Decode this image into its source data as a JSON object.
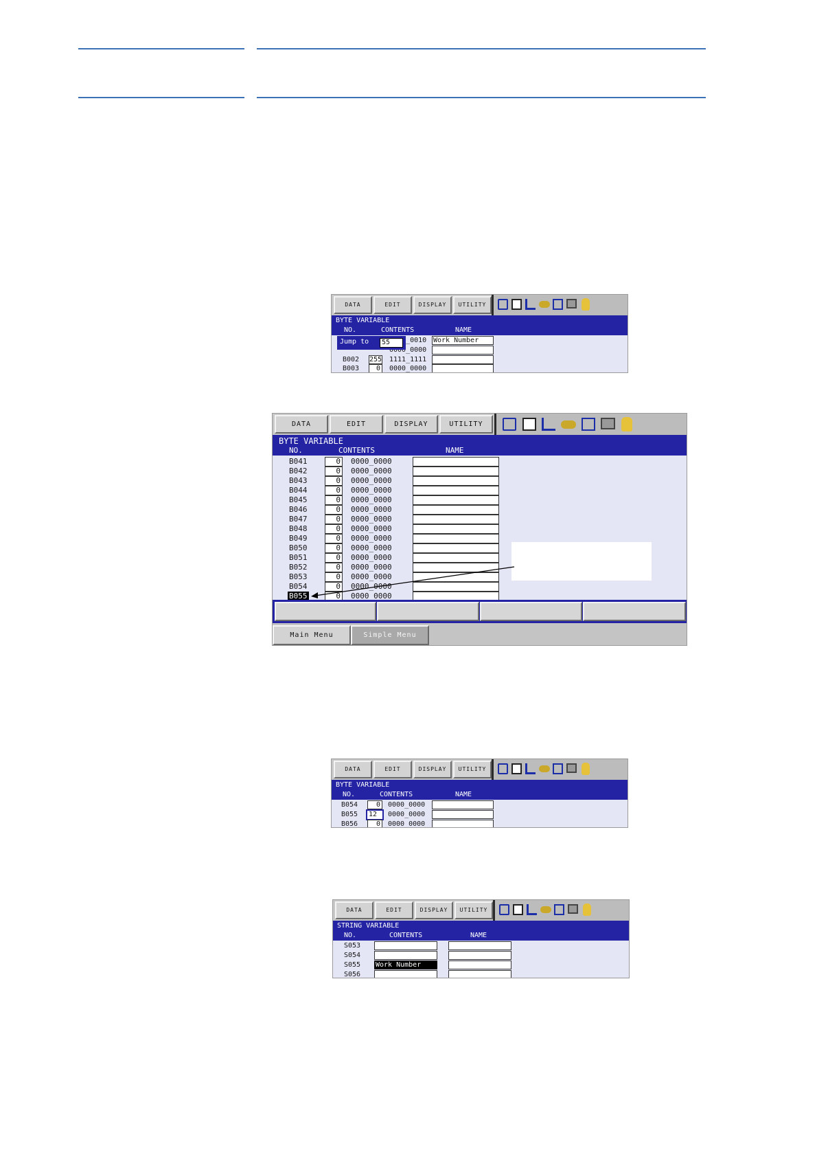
{
  "menu": {
    "data": "DATA",
    "edit": "EDIT",
    "display": "DISPLAY",
    "utility": "UTILITY"
  },
  "icons": [
    "step-icon",
    "edit-lock-icon",
    "signal-icon",
    "key-icon",
    "camera-icon",
    "screen-icon",
    "hand-icon"
  ],
  "colors": {
    "title_bar": "#2323a3",
    "screen_bg": "#e4e6f6",
    "rule": "#3b72b6"
  },
  "screen1": {
    "title": "BYTE VARIABLE",
    "col_no": "NO.",
    "col_contents": "CONTENTS",
    "col_name": "NAME",
    "jump_label": "Jump to",
    "jump_value": "55",
    "row0_bin": "0000_0010",
    "row0_name": "Work Number",
    "row1_bin": "0000_0000",
    "rows": [
      {
        "no": "B002",
        "val": "255",
        "bin": "1111_1111"
      },
      {
        "no": "B003",
        "val": "0",
        "bin": "0000_0000"
      }
    ]
  },
  "screen2": {
    "title": "BYTE VARIABLE",
    "col_no": "NO.",
    "col_contents": "CONTENTS",
    "col_name": "NAME",
    "rows": [
      {
        "no": "B041",
        "val": "0",
        "bin": "0000_0000"
      },
      {
        "no": "B042",
        "val": "0",
        "bin": "0000_0000"
      },
      {
        "no": "B043",
        "val": "0",
        "bin": "0000_0000"
      },
      {
        "no": "B044",
        "val": "0",
        "bin": "0000_0000"
      },
      {
        "no": "B045",
        "val": "0",
        "bin": "0000_0000"
      },
      {
        "no": "B046",
        "val": "0",
        "bin": "0000_0000"
      },
      {
        "no": "B047",
        "val": "0",
        "bin": "0000_0000"
      },
      {
        "no": "B048",
        "val": "0",
        "bin": "0000_0000"
      },
      {
        "no": "B049",
        "val": "0",
        "bin": "0000_0000"
      },
      {
        "no": "B050",
        "val": "0",
        "bin": "0000_0000"
      },
      {
        "no": "B051",
        "val": "0",
        "bin": "0000_0000"
      },
      {
        "no": "B052",
        "val": "0",
        "bin": "0000_0000"
      },
      {
        "no": "B053",
        "val": "0",
        "bin": "0000_0000"
      },
      {
        "no": "B054",
        "val": "0",
        "bin": "0000_0000"
      },
      {
        "no": "B055",
        "val": "0",
        "bin": "0000_0000"
      }
    ],
    "main_menu": "Main Menu",
    "simple_menu": "Simple Menu"
  },
  "screen3": {
    "title": "BYTE VARIABLE",
    "col_no": "NO.",
    "col_contents": "CONTENTS",
    "col_name": "NAME",
    "rows": [
      {
        "no": "B054",
        "val": "0",
        "bin": "0000_0000"
      },
      {
        "no": "B055",
        "val": "12",
        "bin": "0000_0000"
      },
      {
        "no": "B056",
        "val": "0",
        "bin": "0000_0000"
      }
    ]
  },
  "screen4": {
    "title": "STRING VARIABLE",
    "col_no": "NO.",
    "col_contents": "CONTENTS",
    "col_name": "NAME",
    "rows": [
      {
        "no": "S053",
        "text": ""
      },
      {
        "no": "S054",
        "text": ""
      },
      {
        "no": "S055",
        "text": "Work Number"
      },
      {
        "no": "S056",
        "text": ""
      }
    ]
  }
}
